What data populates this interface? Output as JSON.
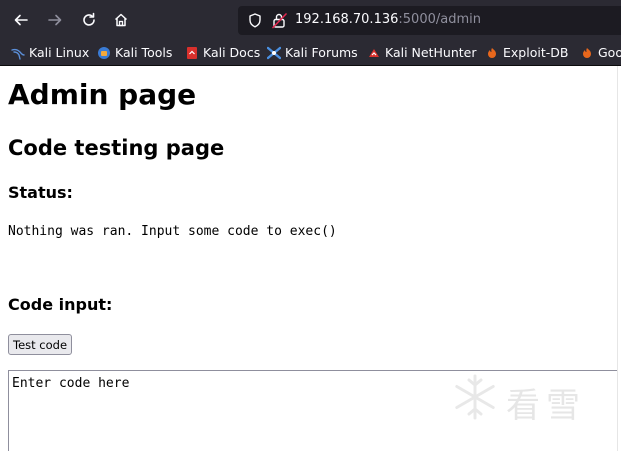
{
  "browser": {
    "url_host": "192.168.70.136",
    "url_rest": ":5000/admin",
    "nav_icons": [
      "back-icon",
      "forward-icon",
      "reload-icon",
      "home-icon"
    ],
    "url_icons": [
      "shield-icon",
      "lock-warning-icon"
    ]
  },
  "bookmarks": [
    {
      "label": "Kali Linux",
      "icon": "kali-dragon-icon"
    },
    {
      "label": "Kali Tools",
      "icon": "kali-tools-icon"
    },
    {
      "label": "Kali Docs",
      "icon": "kali-docs-icon"
    },
    {
      "label": "Kali Forums",
      "icon": "kali-forums-icon"
    },
    {
      "label": "Kali NetHunter",
      "icon": "nethunter-icon"
    },
    {
      "label": "Exploit-DB",
      "icon": "exploit-db-icon"
    },
    {
      "label": "Goo",
      "icon": "ghdb-icon"
    }
  ],
  "page": {
    "title": "Admin page",
    "subtitle": "Code testing page",
    "status_heading": "Status:",
    "status_text": "Nothing was ran. Input some code to exec()",
    "input_heading": "Code input:",
    "test_button": "Test code",
    "code_placeholder": "Enter code here"
  },
  "watermark": {
    "text": "看雪",
    "icon": "snowflake-icon"
  },
  "colors": {
    "chrome_bg": "#2b2a33",
    "url_bg": "#1c1b22",
    "url_host": "#fbfbfe",
    "url_rest": "#8f8f9d",
    "lock_warning": "#e22850"
  }
}
